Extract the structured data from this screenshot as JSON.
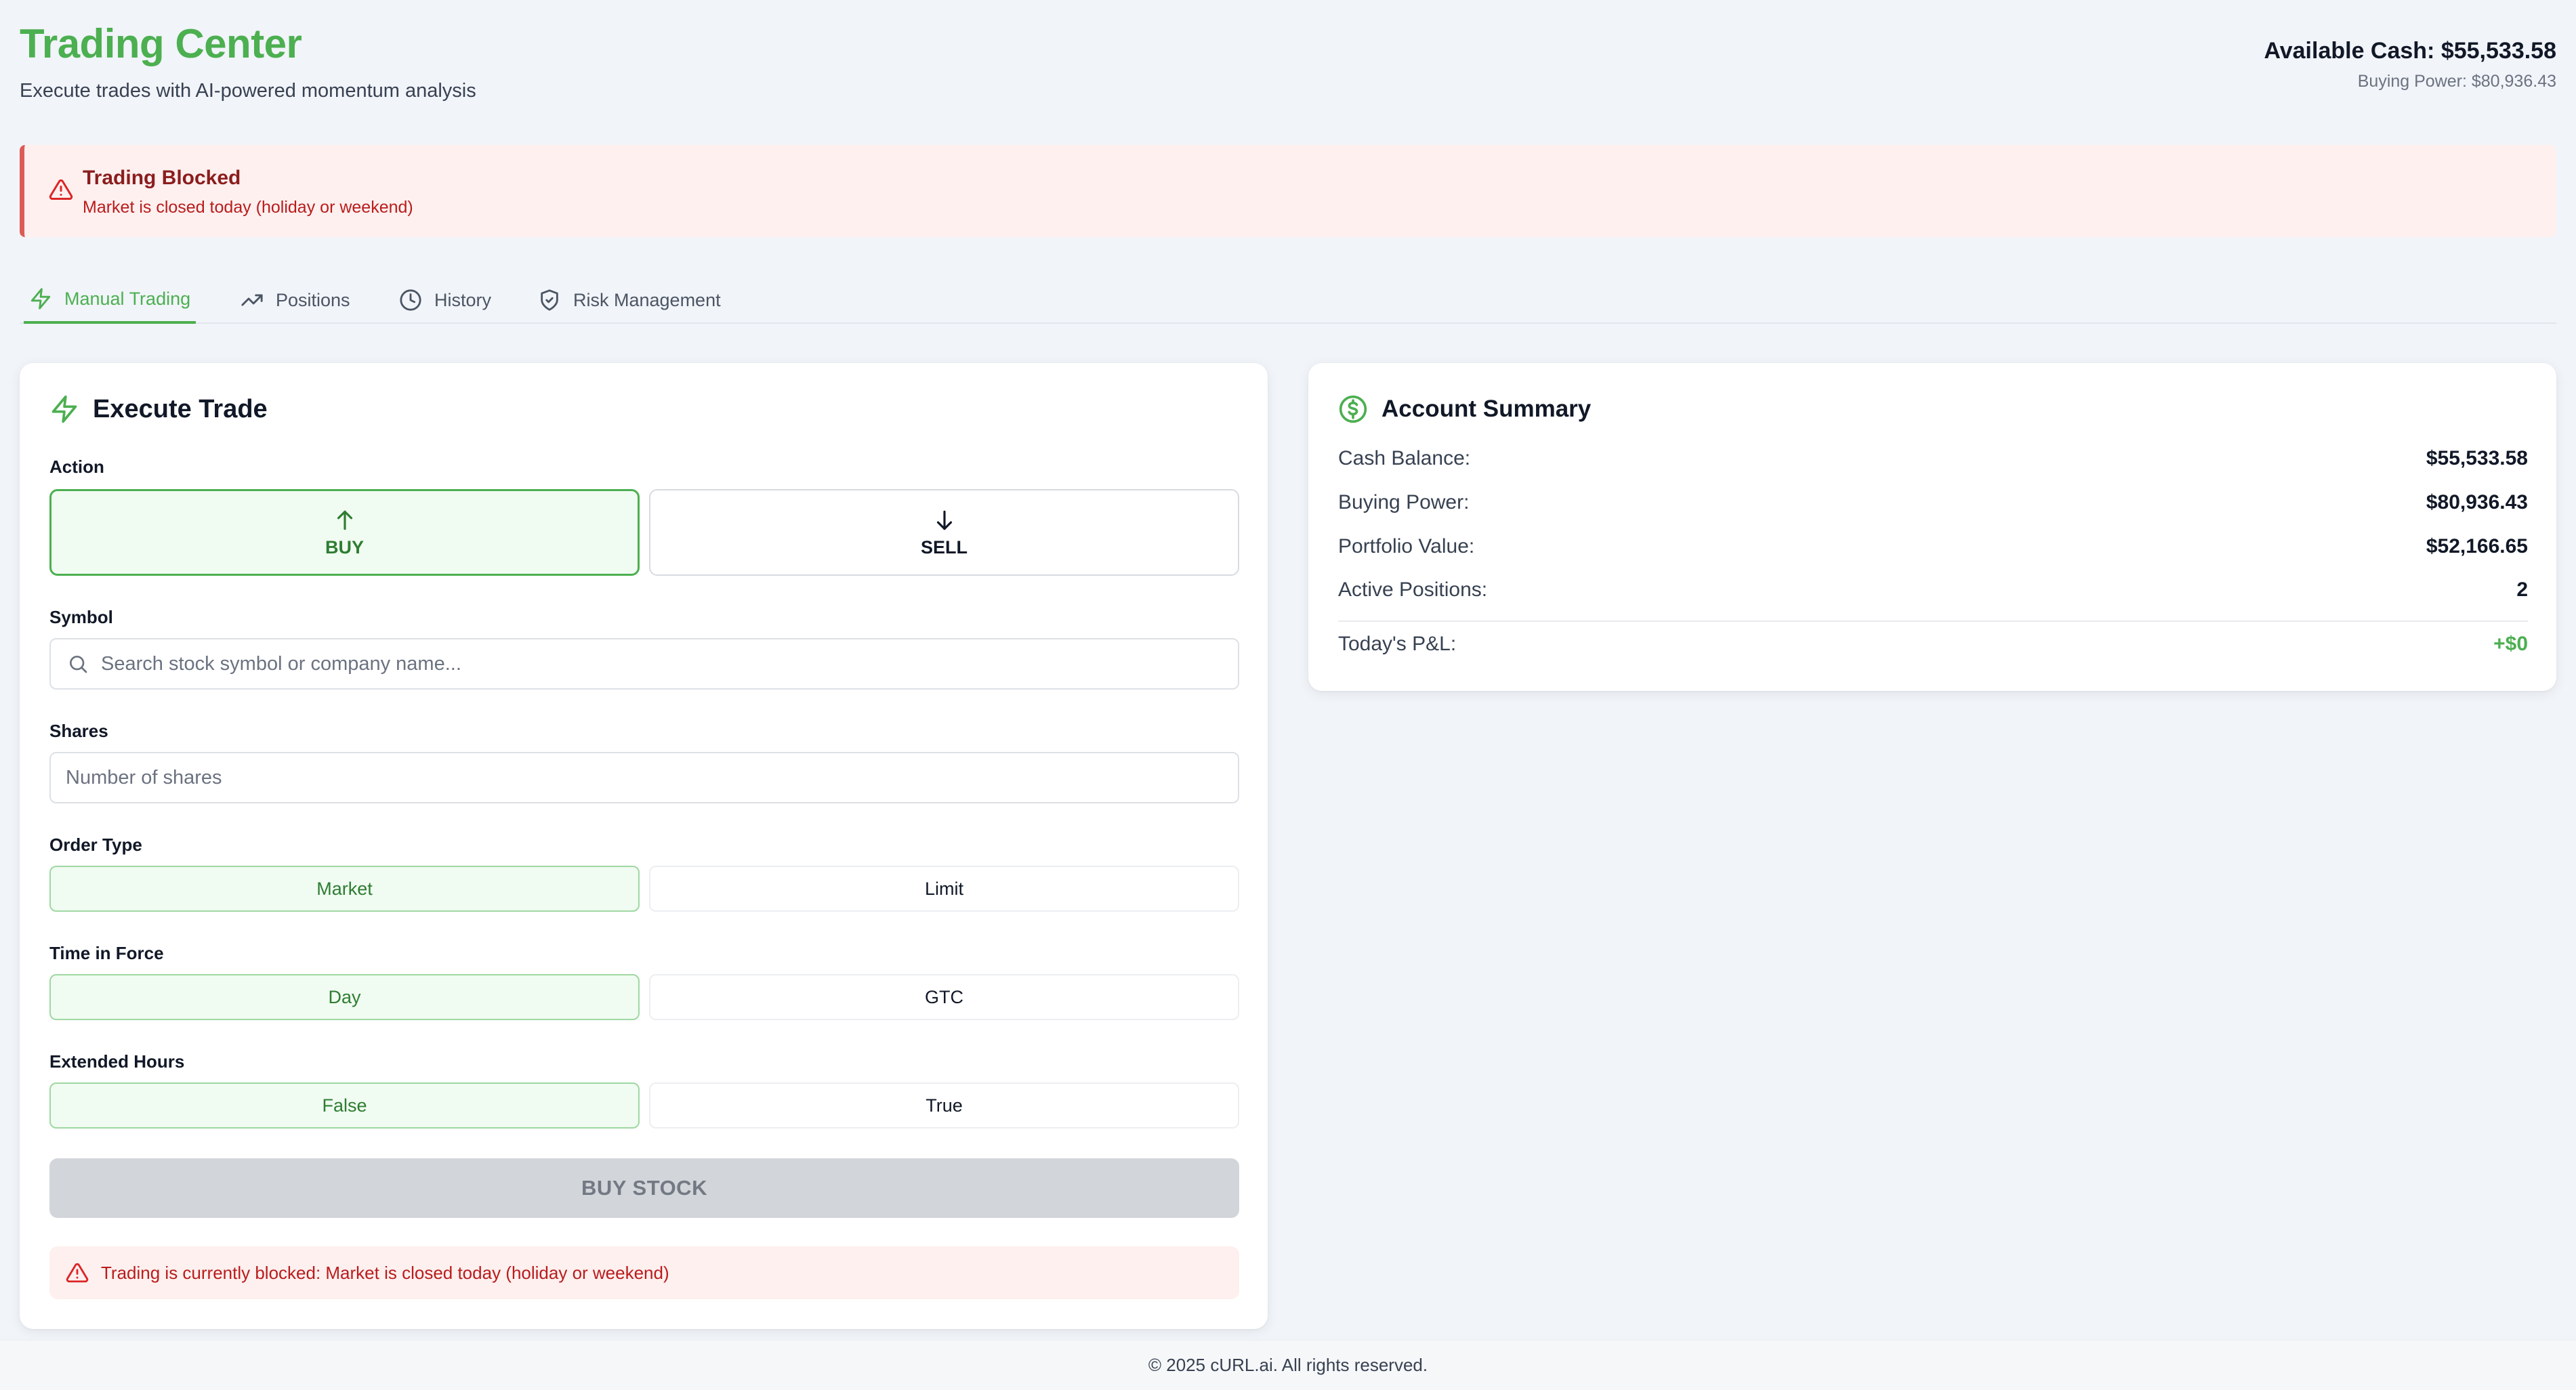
{
  "header": {
    "title": "Trading Center",
    "subtitle": "Execute trades with AI-powered momentum analysis",
    "available_cash": "Available Cash: $55,533.58",
    "buying_power": "Buying Power: $80,936.43"
  },
  "banner": {
    "title": "Trading Blocked",
    "message": "Market is closed today (holiday or weekend)",
    "icon": "warning-triangle-icon"
  },
  "tabs": [
    {
      "label": "Manual Trading",
      "icon": "lightning-icon",
      "active": true
    },
    {
      "label": "Positions",
      "icon": "trending-up-icon",
      "active": false
    },
    {
      "label": "History",
      "icon": "clock-icon",
      "active": false
    },
    {
      "label": "Risk Management",
      "icon": "shield-icon",
      "active": false
    }
  ],
  "trade": {
    "title": "Execute Trade",
    "action_label": "Action",
    "buy_label": "BUY",
    "sell_label": "SELL",
    "symbol_label": "Symbol",
    "symbol_placeholder": "Search stock symbol or company name...",
    "shares_label": "Shares",
    "shares_placeholder": "Number of shares",
    "order_type_label": "Order Type",
    "order_type_options": [
      "Market",
      "Limit"
    ],
    "order_type_selected": "Market",
    "tif_label": "Time in Force",
    "tif_options": [
      "Day",
      "GTC"
    ],
    "tif_selected": "Day",
    "ext_label": "Extended Hours",
    "ext_options": [
      "False",
      "True"
    ],
    "ext_selected": "False",
    "submit_label": "BUY STOCK",
    "error_message": "Trading is currently blocked: Market is closed today (holiday or weekend)"
  },
  "account": {
    "title": "Account Summary",
    "rows": [
      {
        "label": "Cash Balance:",
        "value": "$55,533.58"
      },
      {
        "label": "Buying Power:",
        "value": "$80,936.43"
      },
      {
        "label": "Portfolio Value:",
        "value": "$52,166.65"
      },
      {
        "label": "Active Positions:",
        "value": "2"
      }
    ],
    "pnl_label": "Today's P&L:",
    "pnl_value": "+$0"
  },
  "footer": {
    "text": "© 2025 cURL.ai. All rights reserved."
  },
  "colors": {
    "accent": "#4caf50",
    "danger": "#dc5b55",
    "background": "#f1f4f9"
  }
}
